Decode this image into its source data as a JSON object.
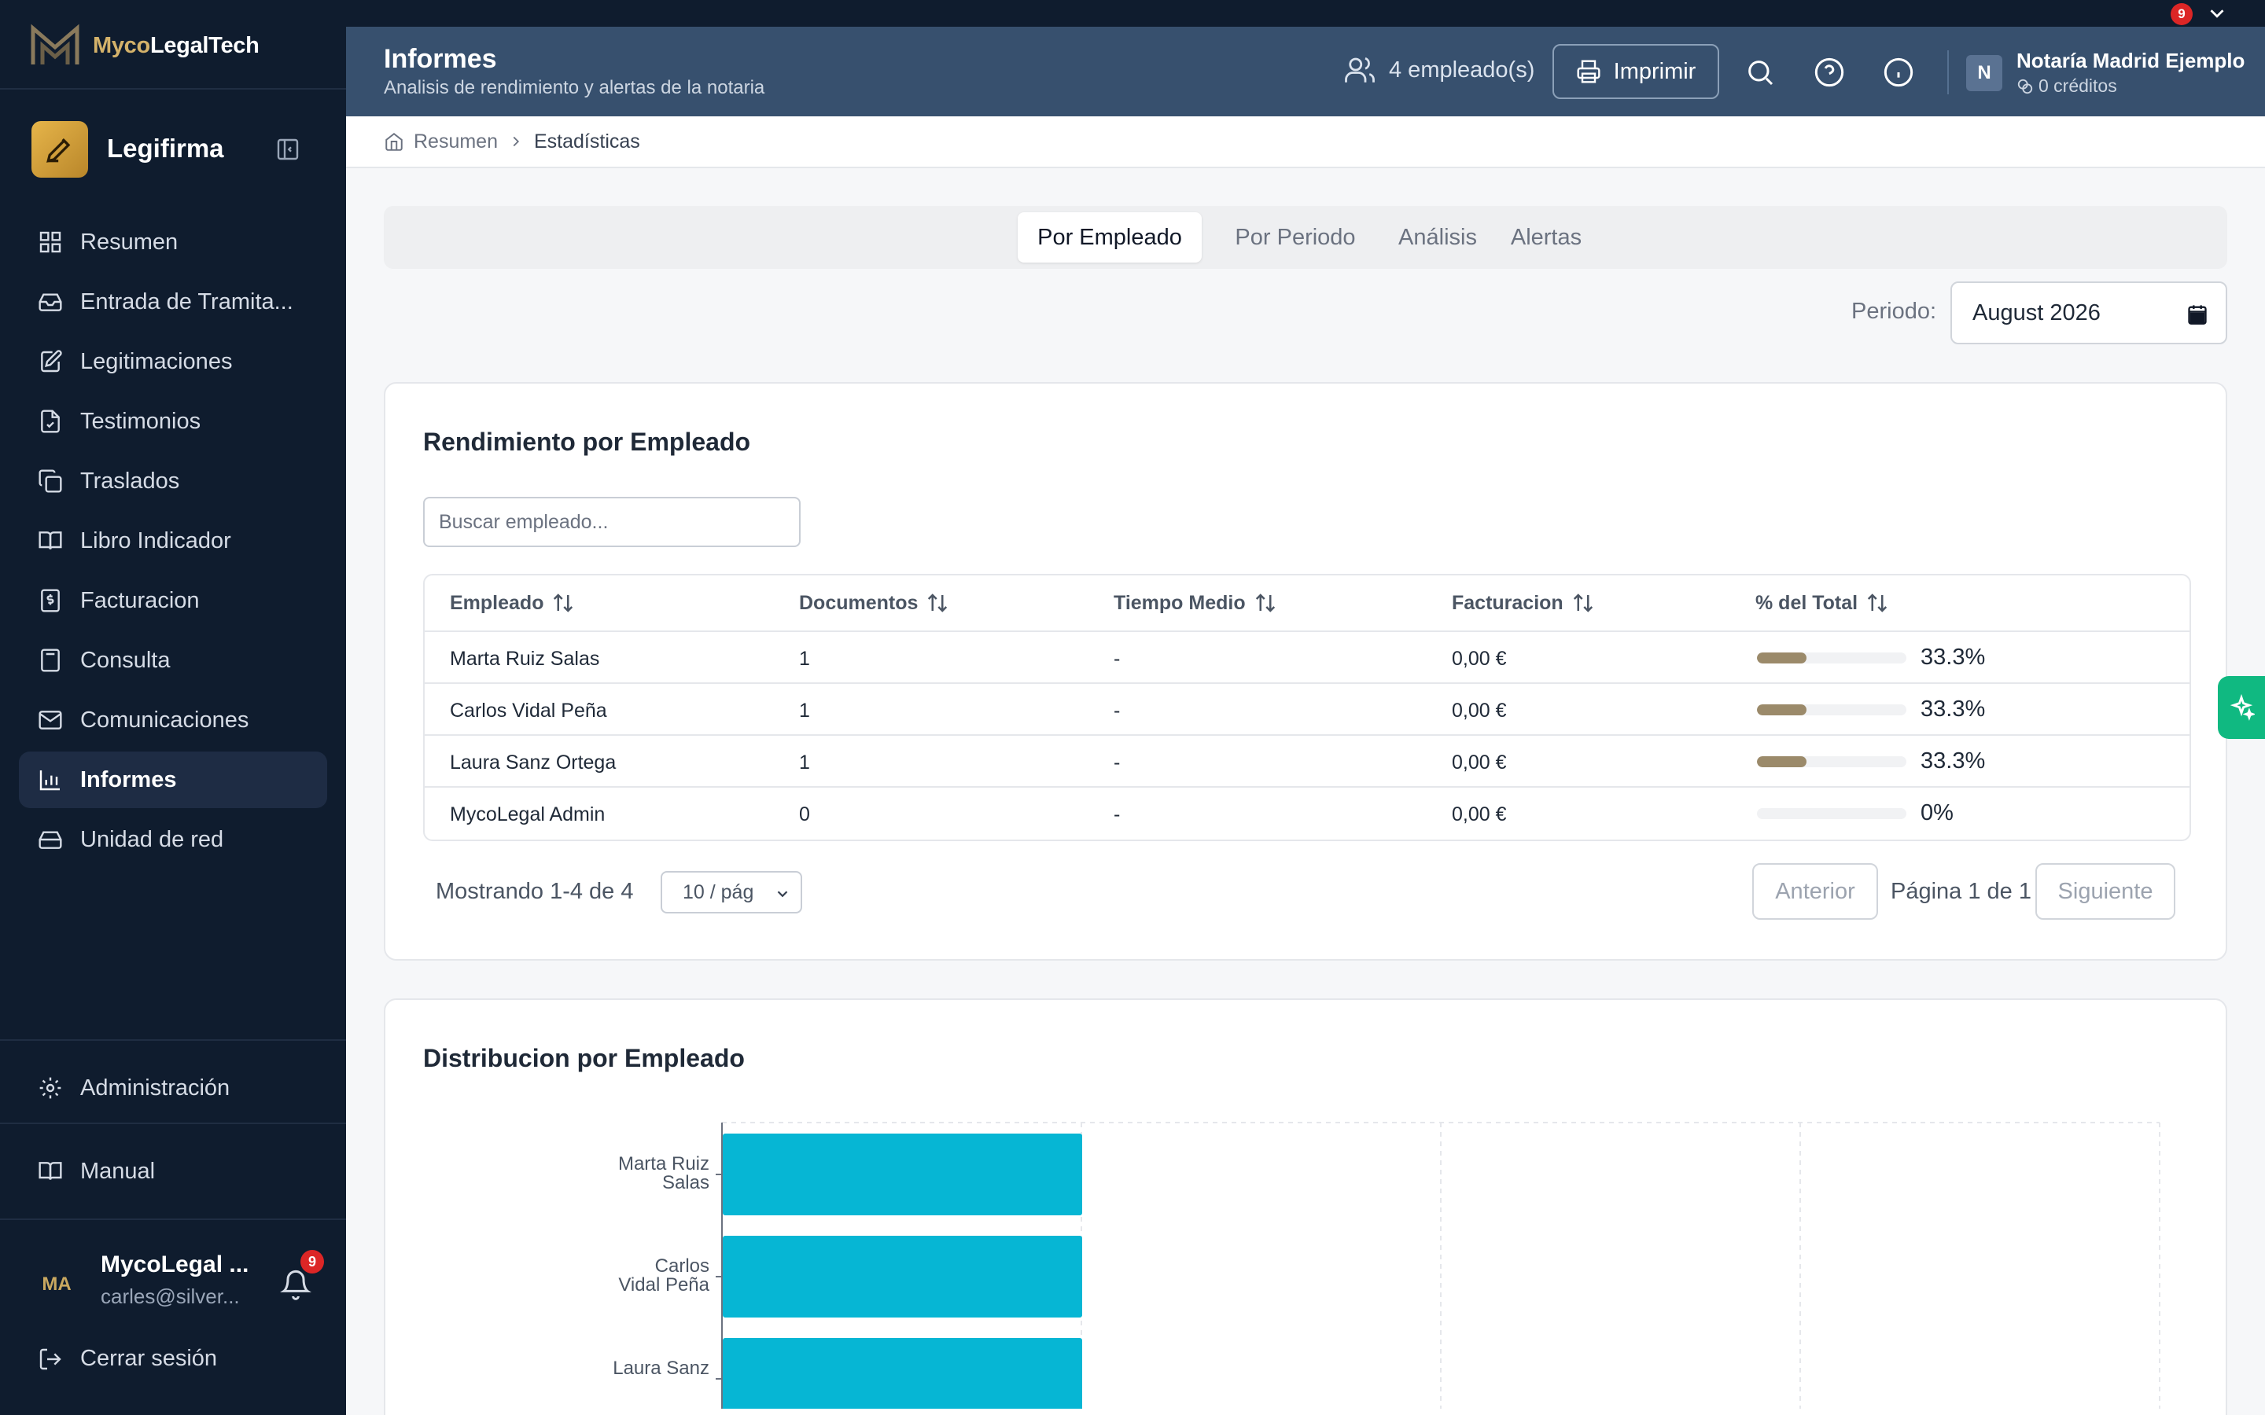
{
  "brand": {
    "myco": "Myco",
    "rest": "LegalTech"
  },
  "app": {
    "name": "Legifirma"
  },
  "top_notif": "9",
  "nav": [
    {
      "label": "Resumen",
      "icon": "grid-icon"
    },
    {
      "label": "Entrada de Tramita...",
      "icon": "inbox-icon"
    },
    {
      "label": "Legitimaciones",
      "icon": "edit-doc-icon"
    },
    {
      "label": "Testimonios",
      "icon": "doc-check-icon"
    },
    {
      "label": "Traslados",
      "icon": "copy-icon"
    },
    {
      "label": "Libro Indicador",
      "icon": "book-icon"
    },
    {
      "label": "Facturacion",
      "icon": "invoice-icon"
    },
    {
      "label": "Consulta",
      "icon": "calculator-icon"
    },
    {
      "label": "Comunicaciones",
      "icon": "mail-icon"
    },
    {
      "label": "Informes",
      "icon": "bar-chart-icon"
    },
    {
      "label": "Unidad de red",
      "icon": "drive-icon"
    }
  ],
  "admin_label": "Administración",
  "manual_label": "Manual",
  "user": {
    "initials": "MA",
    "name": "MycoLegal ...",
    "email": "carles@silver...",
    "badge": "9"
  },
  "logout_label": "Cerrar sesión",
  "header": {
    "title": "Informes",
    "subtitle": "Analisis de rendimiento y alertas de la notaria",
    "employees": "4 empleado(s)",
    "print_label": "Imprimir",
    "org_initial": "N",
    "org_name": "Notaría Madrid Ejemplo",
    "credits": "0 créditos"
  },
  "breadcrumb": {
    "home": "Resumen",
    "current": "Estadísticas"
  },
  "tabs": [
    "Por Empleado",
    "Por Periodo",
    "Análisis",
    "Alertas"
  ],
  "periodo": {
    "label": "Periodo:",
    "value": "August  2026"
  },
  "table_card": {
    "title": "Rendimiento por Empleado",
    "search_placeholder": "Buscar empleado...",
    "columns": [
      "Empleado",
      "Documentos",
      "Tiempo Medio",
      "Facturacion",
      "% del Total"
    ],
    "rows": [
      {
        "name": "Marta Ruiz Salas",
        "docs": "1",
        "time": "-",
        "billing": "0,00 €",
        "pct": "33.3%",
        "share": 0.333
      },
      {
        "name": "Carlos Vidal Peña",
        "docs": "1",
        "time": "-",
        "billing": "0,00 €",
        "pct": "33.3%",
        "share": 0.333
      },
      {
        "name": "Laura Sanz Ortega",
        "docs": "1",
        "time": "-",
        "billing": "0,00 €",
        "pct": "33.3%",
        "share": 0.333
      },
      {
        "name": "MycoLegal Admin",
        "docs": "0",
        "time": "-",
        "billing": "0,00 €",
        "pct": "0%",
        "share": 0
      }
    ],
    "showing": "Mostrando 1-4 de 4",
    "per_page": "10 / pág",
    "prev": "Anterior",
    "page_info": "Página 1 de 1",
    "next": "Siguiente"
  },
  "chart_card": {
    "title": "Distribucion por Empleado"
  },
  "chart_data": {
    "type": "bar",
    "orientation": "horizontal",
    "categories": [
      [
        "Marta Ruiz",
        "Salas"
      ],
      [
        "Carlos",
        "Vidal Peña"
      ],
      [
        "Laura Sanz",
        ""
      ]
    ],
    "values": [
      1,
      1,
      1
    ],
    "xlim": [
      0,
      4
    ],
    "grid": true,
    "color": "#06b6d4"
  },
  "colors": {
    "sidebar": "#0f1c2e",
    "header": "#37506e",
    "accent": "#9b8a6a",
    "bar": "#06b6d4",
    "fab": "#10b981"
  }
}
